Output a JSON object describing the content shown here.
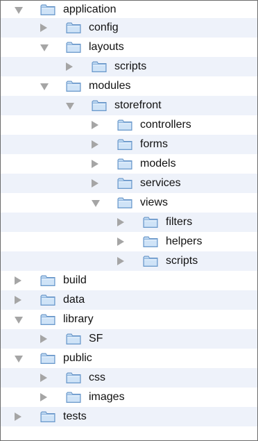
{
  "tree": {
    "icons": {
      "folder": "folder-icon",
      "expanded": "disclosure-triangle-open-icon",
      "collapsed": "disclosure-triangle-closed-icon"
    },
    "colors": {
      "folder_fill": "#bcd7f1",
      "folder_stroke": "#5f8fc4",
      "triangle": "#a5a5a5",
      "alternate_row": "#eef2fa"
    },
    "items": [
      {
        "label": "application",
        "depth": 0,
        "expanded": true
      },
      {
        "label": "config",
        "depth": 1,
        "expanded": false
      },
      {
        "label": "layouts",
        "depth": 1,
        "expanded": true
      },
      {
        "label": "scripts",
        "depth": 2,
        "expanded": false
      },
      {
        "label": "modules",
        "depth": 1,
        "expanded": true
      },
      {
        "label": "storefront",
        "depth": 2,
        "expanded": true
      },
      {
        "label": "controllers",
        "depth": 3,
        "expanded": false
      },
      {
        "label": "forms",
        "depth": 3,
        "expanded": false
      },
      {
        "label": "models",
        "depth": 3,
        "expanded": false
      },
      {
        "label": "services",
        "depth": 3,
        "expanded": false
      },
      {
        "label": "views",
        "depth": 3,
        "expanded": true
      },
      {
        "label": "filters",
        "depth": 4,
        "expanded": false
      },
      {
        "label": "helpers",
        "depth": 4,
        "expanded": false
      },
      {
        "label": "scripts",
        "depth": 4,
        "expanded": false
      },
      {
        "label": "build",
        "depth": 0,
        "expanded": false
      },
      {
        "label": "data",
        "depth": 0,
        "expanded": false
      },
      {
        "label": "library",
        "depth": 0,
        "expanded": true
      },
      {
        "label": "SF",
        "depth": 1,
        "expanded": false
      },
      {
        "label": "public",
        "depth": 0,
        "expanded": true
      },
      {
        "label": "css",
        "depth": 1,
        "expanded": false
      },
      {
        "label": "images",
        "depth": 1,
        "expanded": false
      },
      {
        "label": "tests",
        "depth": 0,
        "expanded": false
      }
    ]
  }
}
